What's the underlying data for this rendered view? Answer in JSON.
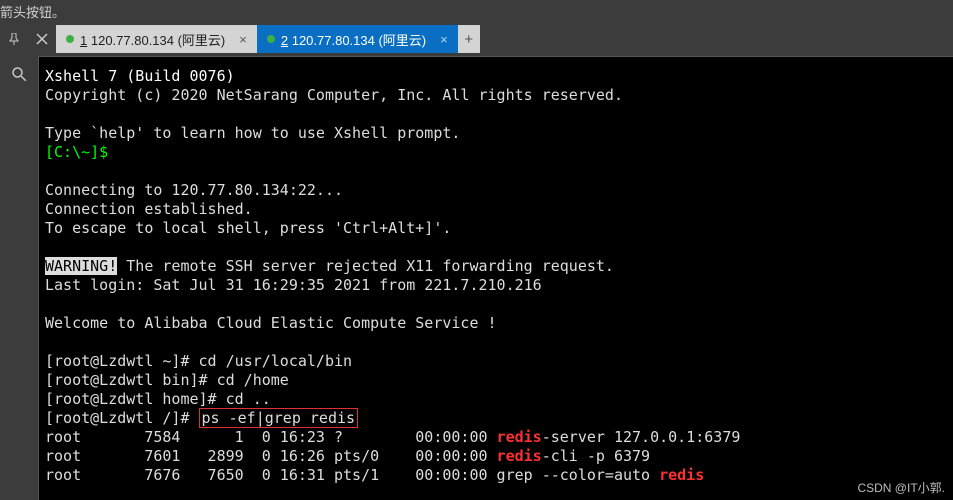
{
  "hint_text": "箭头按钮。",
  "tabs": [
    {
      "num": "1",
      "label": "120.77.80.134  (阿里云)",
      "active": false
    },
    {
      "num": "2",
      "label": "120.77.80.134  (阿里云)",
      "active": true
    }
  ],
  "add_tab": "+",
  "term": {
    "banner1": "Xshell 7 (Build 0076)",
    "banner2": "Copyright (c) 2020 NetSarang Computer, Inc. All rights reserved.",
    "help": "Type `help' to learn how to use Xshell prompt.",
    "prompt_local": "[C:\\~]$",
    "connecting": "Connecting to 120.77.80.134:22...",
    "established": "Connection established.",
    "escape": "To escape to local shell, press 'Ctrl+Alt+]'.",
    "warn_label": "WARNING!",
    "warn_rest": " The remote SSH server rejected X11 forwarding request.",
    "last_login": "Last login: Sat Jul 31 16:29:35 2021 from 221.7.210.216",
    "welcome": "Welcome to Alibaba Cloud Elastic Compute Service !",
    "cmd1_prompt": "[root@Lzdwtl ~]# ",
    "cmd1": "cd /usr/local/bin",
    "cmd2_prompt": "[root@Lzdwtl bin]# ",
    "cmd2": "cd /home",
    "cmd3_prompt": "[root@Lzdwtl home]# ",
    "cmd3": "cd ..",
    "cmd4_prompt": "[root@Lzdwtl /]# ",
    "cmd4": "ps -ef|grep redis",
    "ps": [
      {
        "pre": "root       7584      1  0 16:23 ?        00:00:00 ",
        "hi": "redis",
        "post": "-server 127.0.0.1:6379"
      },
      {
        "pre": "root       7601   2899  0 16:26 pts/0    00:00:00 ",
        "hi": "redis",
        "post": "-cli -p 6379"
      },
      {
        "pre": "root       7676   7650  0 16:31 pts/1    00:00:00 grep --color=auto ",
        "hi": "redis",
        "post": ""
      }
    ]
  },
  "watermark": "CSDN @IT小郭."
}
